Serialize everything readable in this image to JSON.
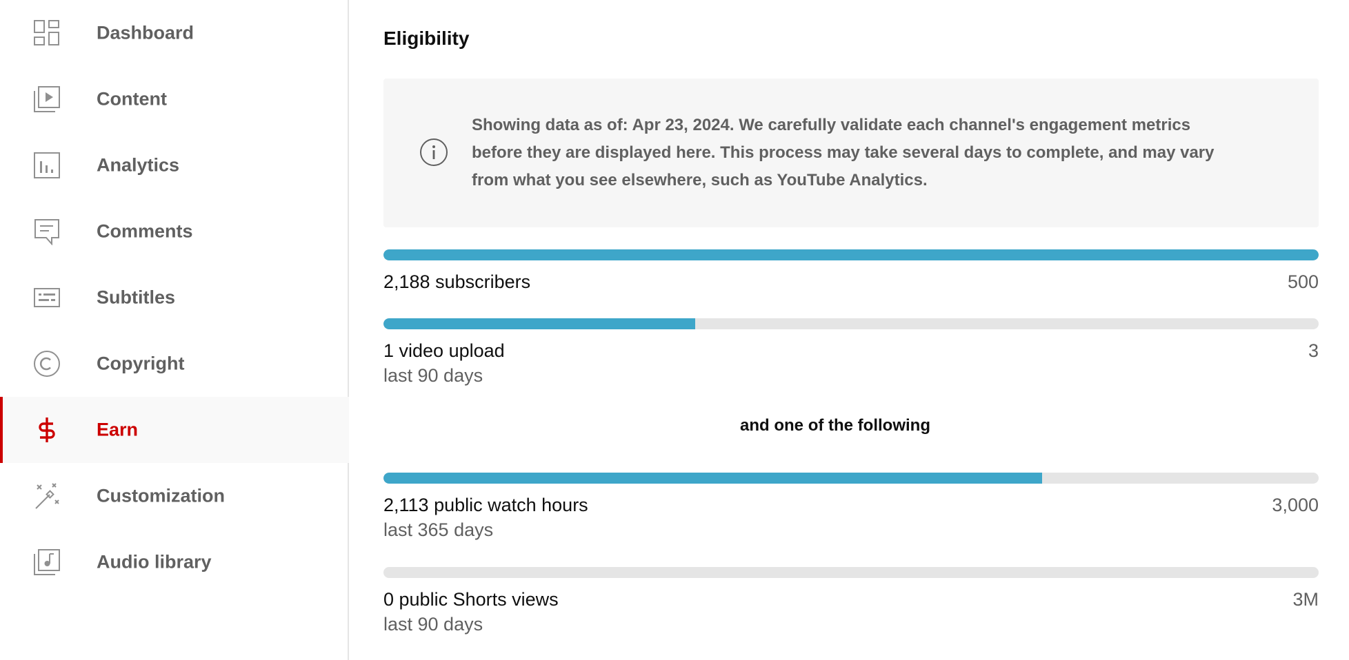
{
  "sidebar": {
    "items": [
      {
        "label": "Dashboard",
        "icon": "dashboard-icon",
        "active": false
      },
      {
        "label": "Content",
        "icon": "content-icon",
        "active": false
      },
      {
        "label": "Analytics",
        "icon": "analytics-icon",
        "active": false
      },
      {
        "label": "Comments",
        "icon": "comments-icon",
        "active": false
      },
      {
        "label": "Subtitles",
        "icon": "subtitles-icon",
        "active": false
      },
      {
        "label": "Copyright",
        "icon": "copyright-icon",
        "active": false
      },
      {
        "label": "Earn",
        "icon": "earn-icon",
        "active": true
      },
      {
        "label": "Customization",
        "icon": "customization-icon",
        "active": false
      },
      {
        "label": "Audio library",
        "icon": "audio-library-icon",
        "active": false
      }
    ]
  },
  "main": {
    "title": "Eligibility",
    "info_text": "Showing data as of: Apr 23, 2024. We carefully validate each channel's engagement metrics before they are displayed here. This process may take several days to complete, and may vary from what you see elsewhere, such as YouTube Analytics.",
    "divider_text": "and one of the following",
    "metrics": [
      {
        "label": "2,188 subscribers",
        "target": "500",
        "sub": "",
        "progress": 1.0
      },
      {
        "label": "1 video upload",
        "target": "3",
        "sub": "last 90 days",
        "progress": 0.3333
      },
      {
        "label": "2,113 public watch hours",
        "target": "3,000",
        "sub": "last 365 days",
        "progress": 0.7043
      },
      {
        "label": "0 public Shorts views",
        "target": "3M",
        "sub": "last 90 days",
        "progress": 0.0
      }
    ]
  },
  "colors": {
    "accent": "#cc0000",
    "progress": "#3ea6c9",
    "track": "#e5e5e5",
    "info_bg": "#f6f6f6"
  }
}
